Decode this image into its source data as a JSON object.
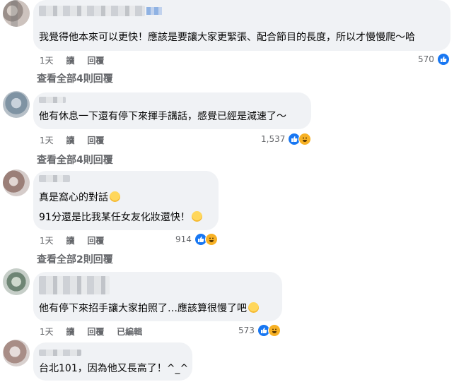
{
  "comments": [
    {
      "text": "我覺得他本來可以更快！應該是要讓大家更緊張、配合節目的長度，所以才慢慢爬～哈",
      "time": "1天",
      "read": "讀",
      "reply": "回覆",
      "reaction_count": "570",
      "view_replies": "查看全部4則回覆"
    },
    {
      "text": "他有休息一下還有停下來揮手講話，感覺已經是減速了～",
      "time": "1天",
      "read": "讀",
      "reply": "回覆",
      "reaction_count": "1,537",
      "view_replies": "查看全部4則回覆"
    },
    {
      "text_line1": "真是窩心的對話",
      "text_line2": "91分還是比我某任女友化妝還快！",
      "time": "1天",
      "read": "讀",
      "reply": "回覆",
      "reaction_count": "914",
      "view_replies": "查看全部2則回覆"
    },
    {
      "text": "他有停下來招手讓大家拍照了…應該算很慢了吧",
      "time": "1天",
      "read": "讀",
      "reply": "回覆",
      "edited": "已編輯",
      "reaction_count": "573"
    },
    {
      "text": "台北101，因為他又長高了！^_^"
    }
  ],
  "icons": {
    "like": "like-icon",
    "haha": "haha-icon",
    "smile": "smiling-face-icon",
    "laugh": "laughing-face-icon"
  },
  "colors": {
    "like": "#1877f2",
    "haha": "#f7b125",
    "bubble": "#f0f2f5",
    "meta": "#65676b"
  }
}
